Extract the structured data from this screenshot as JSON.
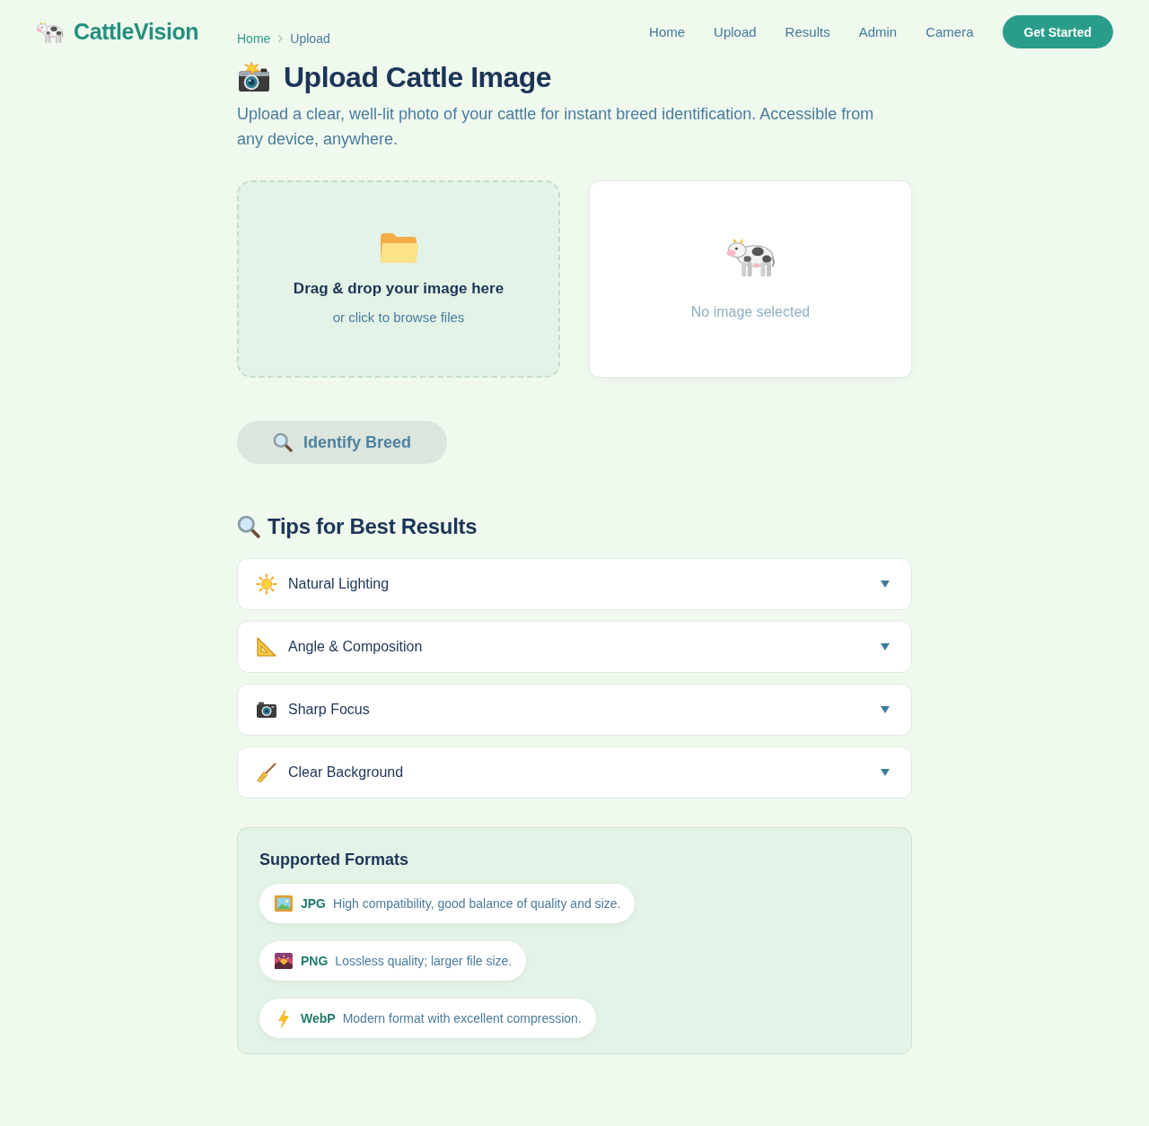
{
  "header": {
    "logo": "CattleVision",
    "nav": [
      {
        "label": "Home",
        "selected": false
      },
      {
        "label": "Upload",
        "selected": false
      },
      {
        "label": "Results",
        "selected": false
      },
      {
        "label": "Admin",
        "selected": false
      },
      {
        "label": "Camera",
        "selected": false
      }
    ],
    "cta": "Get Started"
  },
  "breadcrumb": [
    {
      "label": "Home",
      "current": false
    },
    {
      "label": "Upload",
      "current": true
    }
  ],
  "hero": {
    "title": "Upload Cattle Image",
    "description": "Upload a clear, well-lit photo of your cattle for instant breed identification. Accessible from any device, anywhere."
  },
  "dropzone": {
    "title": "Drag & drop your image here",
    "hint": "or click to browse files"
  },
  "preview": {
    "empty_message": "No image selected"
  },
  "identify_button": {
    "label": "Identify Breed",
    "disabled": true
  },
  "tips": {
    "title": "Tips for Best Results",
    "items": [
      {
        "label": "Natural Lighting",
        "expanded": false
      },
      {
        "label": "Angle & Composition",
        "expanded": false
      },
      {
        "label": "Sharp Focus",
        "expanded": false
      },
      {
        "label": "Clear Background",
        "expanded": false
      }
    ]
  },
  "formats": {
    "title": "Supported Formats",
    "items": [
      {
        "name": "JPG",
        "description": "High compatibility, good balance of quality and size."
      },
      {
        "name": "PNG",
        "description": "Lossless quality; larger file size."
      },
      {
        "name": "WebP",
        "description": "Modern format with excellent compression."
      }
    ]
  }
}
